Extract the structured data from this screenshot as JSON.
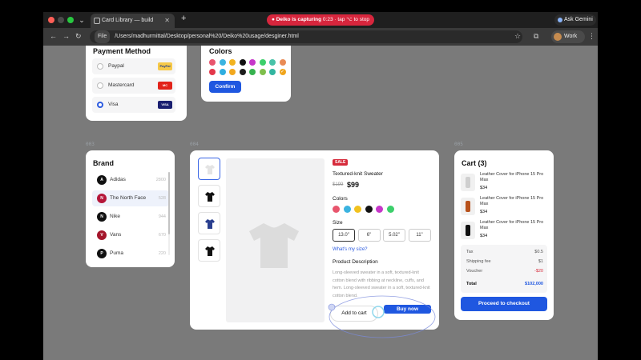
{
  "browser": {
    "tab_title": "Card Library — build",
    "recording": "Deiko is capturing",
    "recording_time": "0:23",
    "recording_hint": "tap ⌥ to stop",
    "gemini": "Ask Gemini",
    "url_chip": "File",
    "url": "/Users/madhurmittal/Desktop/personal%20/Deiko%20usage/desginer.html",
    "profile": "Work"
  },
  "payment": {
    "title": "Payment Method",
    "options": [
      {
        "label": "Paypal",
        "badge": "PayPal"
      },
      {
        "label": "Mastercard",
        "badge": "MC"
      },
      {
        "label": "Visa",
        "badge": "VISA"
      }
    ]
  },
  "colors_card": {
    "title": "Colors",
    "confirm": "Confirm",
    "swatches": [
      "#e8556d",
      "#3bb3e0",
      "#f2b320",
      "#111111",
      "#c637c9",
      "#3ccf6b",
      "#48c2a8",
      "#e98b55",
      "#e3384a",
      "#2faee0",
      "#f2a81e",
      "#1d1d1d",
      "#36b24f",
      "#7fbf4d",
      "#32b5a0",
      "#f0a51c"
    ]
  },
  "brand": {
    "label": "003",
    "title": "Brand",
    "items": [
      {
        "initial": "A",
        "name": "Adidas",
        "count": "2800",
        "color": "#111111"
      },
      {
        "initial": "N",
        "name": "The North Face",
        "count": "528",
        "color": "#b5173a"
      },
      {
        "initial": "N",
        "name": "Nike",
        "count": "944",
        "color": "#111111"
      },
      {
        "initial": "V",
        "name": "Vans",
        "count": "670",
        "color": "#a4162b"
      },
      {
        "initial": "P",
        "name": "Puma",
        "count": "220",
        "color": "#111111"
      }
    ]
  },
  "product": {
    "label": "004",
    "sale": "SALE",
    "name": "Textured-knit Sweater",
    "old_price": "$199",
    "price": "$99",
    "colors_label": "Colors",
    "colors": [
      "#e8556d",
      "#3bb3e0",
      "#f2c21e",
      "#111111",
      "#c637c9",
      "#3ccf6b"
    ],
    "size_label": "Size",
    "sizes": [
      "13.0\"",
      "6\"",
      "5.02\"",
      "11\""
    ],
    "size_help": "What's my size?",
    "desc_title": "Product Description",
    "desc": "Long-sleeved sweater in a soft, textured-knit cotton blend with ribbing at neckline, cuffs, and hem. Long-sleeved sweater in a soft, textured-knit cotton blend.",
    "add_to_cart": "Add to cart",
    "buy_now": "Buy now"
  },
  "cart": {
    "label": "005",
    "title": "Cart (3)",
    "items": [
      {
        "name": "Leather Cover for iPhone 15 Pro Max",
        "price": "$34",
        "color": "#cfcfcf"
      },
      {
        "name": "Leather Cover for iPhone 15 Pro Max",
        "price": "$34",
        "color": "#b8521c"
      },
      {
        "name": "Leather Cover for iPhone 15 Pro Max",
        "price": "$34",
        "color": "#111111"
      }
    ],
    "summary": [
      {
        "k": "Tax",
        "v": "$0.5"
      },
      {
        "k": "Shipping fee",
        "v": "$1"
      },
      {
        "k": "Voucher",
        "v": "-$20"
      }
    ],
    "total_label": "Total",
    "total": "$102,000",
    "checkout": "Proceed to checkout"
  }
}
